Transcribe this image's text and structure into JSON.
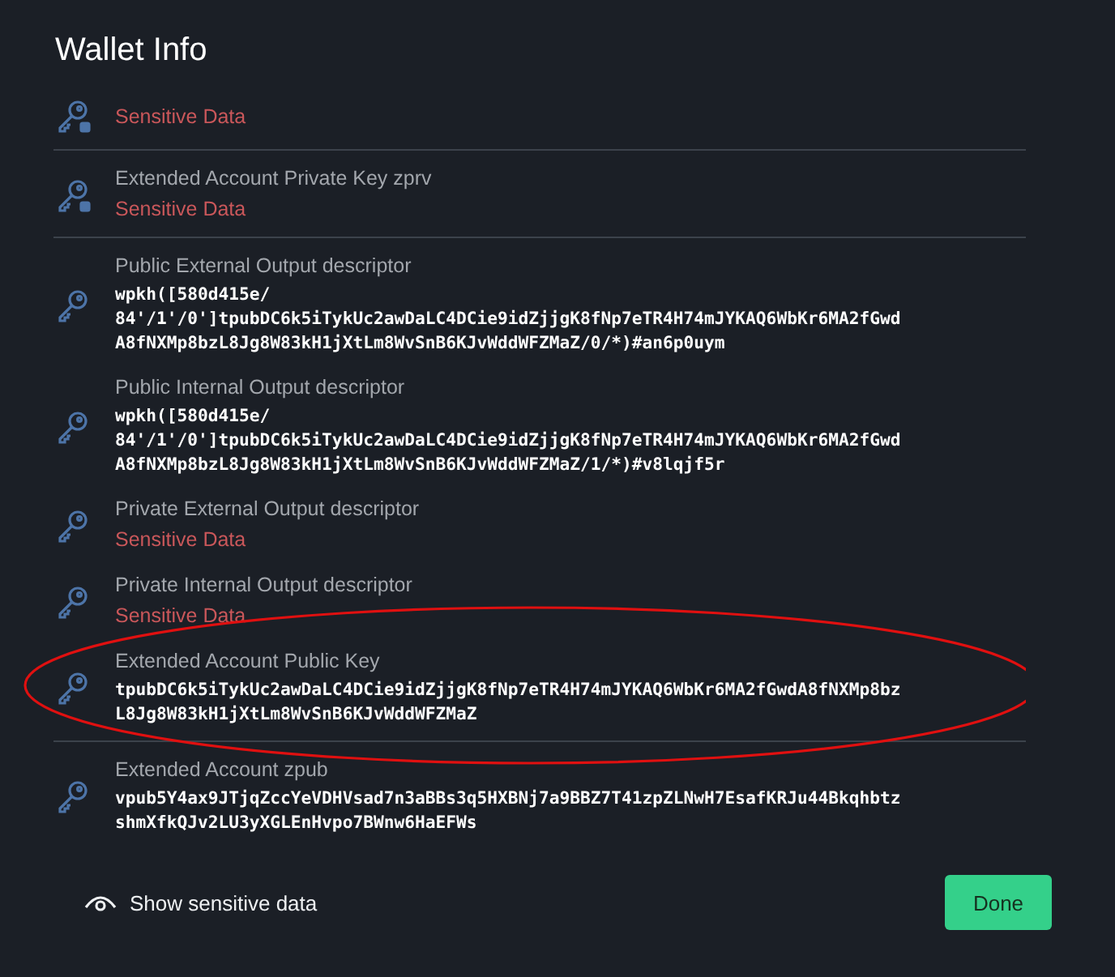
{
  "title": "Wallet Info",
  "sections": [
    {
      "items": [
        {
          "kind": "sensitive",
          "locked": true,
          "value": "Sensitive Data"
        }
      ]
    },
    {
      "items": [
        {
          "kind": "sensitive",
          "locked": true,
          "label": "Extended Account Private Key zprv",
          "value": "Sensitive Data"
        }
      ]
    },
    {
      "items": [
        {
          "kind": "value",
          "locked": false,
          "label": "Public External Output descriptor",
          "value": "wpkh([580d415e/\n84'/1'/0']tpubDC6k5iTykUc2awDaLC4DCie9idZjjgK8fNp7eTR4H74mJYKAQ6WbKr6MA2fGwd\nA8fNXMp8bzL8Jg8W83kH1jXtLm8WvSnB6KJvWddWFZMaZ/0/*)#an6p0uym"
        },
        {
          "kind": "value",
          "locked": false,
          "label": "Public Internal Output descriptor",
          "value": "wpkh([580d415e/\n84'/1'/0']tpubDC6k5iTykUc2awDaLC4DCie9idZjjgK8fNp7eTR4H74mJYKAQ6WbKr6MA2fGwd\nA8fNXMp8bzL8Jg8W83kH1jXtLm8WvSnB6KJvWddWFZMaZ/1/*)#v8lqjf5r"
        },
        {
          "kind": "sensitive",
          "locked": false,
          "label": "Private External Output descriptor",
          "value": "Sensitive Data"
        },
        {
          "kind": "sensitive",
          "locked": false,
          "label": "Private Internal Output descriptor",
          "value": "Sensitive Data"
        },
        {
          "kind": "value",
          "locked": false,
          "label": "Extended Account Public Key",
          "value": "tpubDC6k5iTykUc2awDaLC4DCie9idZjjgK8fNp7eTR4H74mJYKAQ6WbKr6MA2fGwdA8fNXMp8bz\nL8Jg8W83kH1jXtLm8WvSnB6KJvWddWFZMaZ",
          "annotation": {
            "kind": "ellipse"
          }
        }
      ]
    },
    {
      "items": [
        {
          "kind": "value",
          "locked": false,
          "label": "Extended Account zpub",
          "value": "vpub5Y4ax9JTjqZccYeVDHVsad7n3aBBs3q5HXBNj7a9BBZ7T41zpZLNwH7EsafKRJu44Bkqhbtz\nshmXfkQJv2LU3yXGLEnHvpo7BWnw6HaEFWs"
        }
      ]
    }
  ],
  "toggle": {
    "label": "Show sensitive data"
  },
  "done": {
    "label": "Done"
  }
}
